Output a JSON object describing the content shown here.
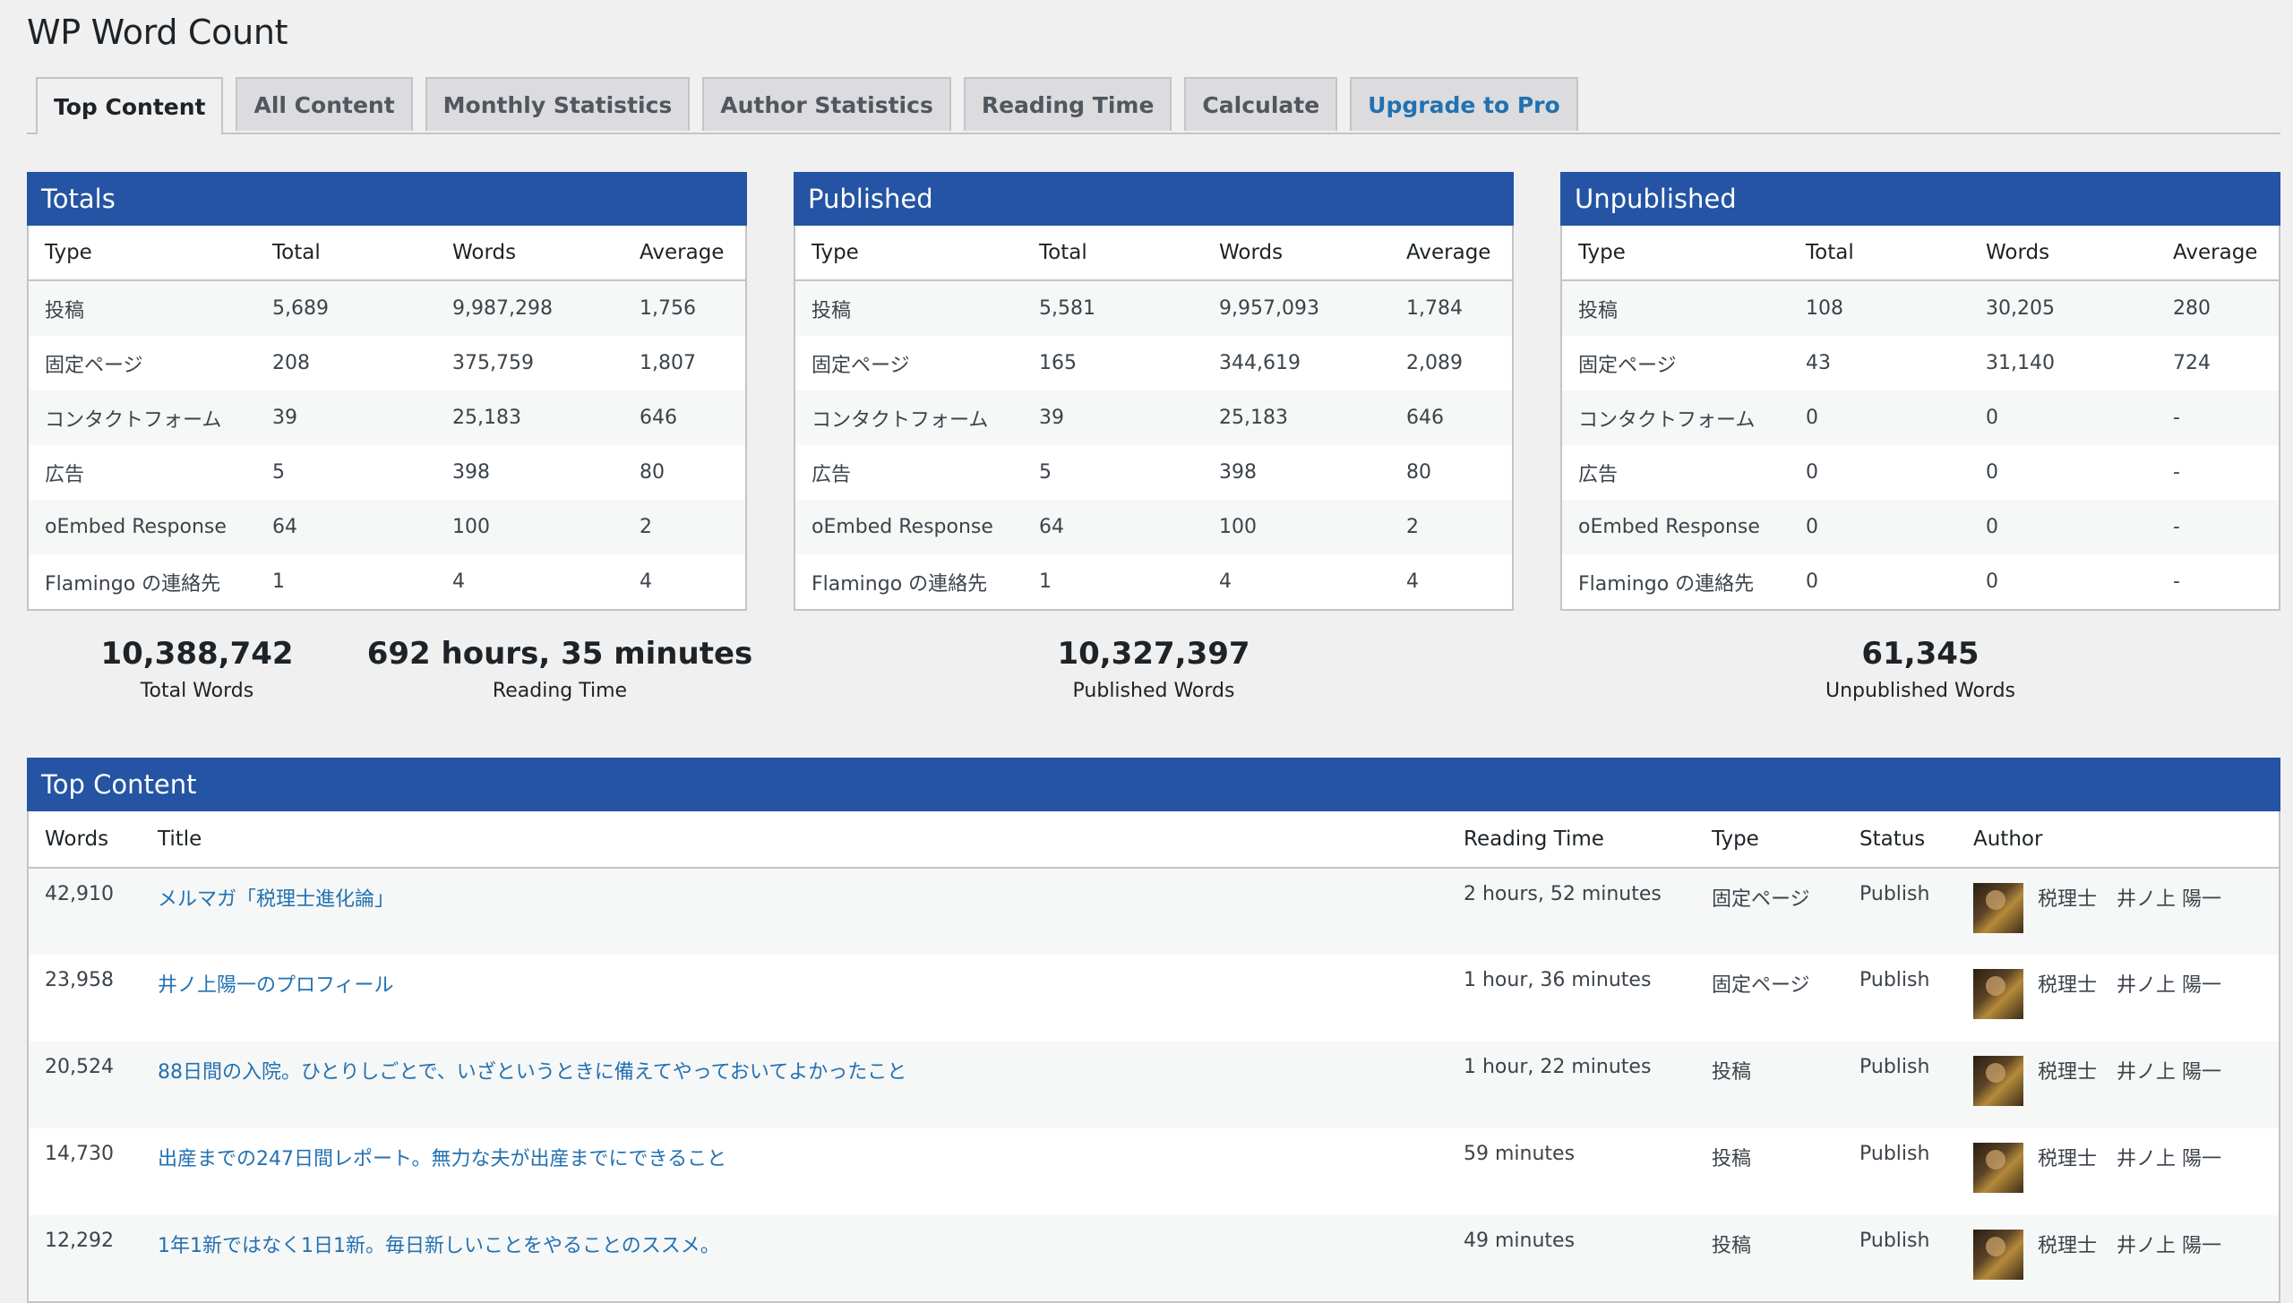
{
  "page_title": "WP Word Count",
  "tabs": [
    "Top Content",
    "All Content",
    "Monthly Statistics",
    "Author Statistics",
    "Reading Time",
    "Calculate",
    "Upgrade to Pro"
  ],
  "columns": [
    "Type",
    "Total",
    "Words",
    "Average"
  ],
  "totals": {
    "title": "Totals",
    "rows": [
      [
        "投稿",
        "5,689",
        "9,987,298",
        "1,756"
      ],
      [
        "固定ページ",
        "208",
        "375,759",
        "1,807"
      ],
      [
        "コンタクトフォーム",
        "39",
        "25,183",
        "646"
      ],
      [
        "広告",
        "5",
        "398",
        "80"
      ],
      [
        "oEmbed Response",
        "64",
        "100",
        "2"
      ],
      [
        "Flamingo の連絡先",
        "1",
        "4",
        "4"
      ]
    ]
  },
  "published": {
    "title": "Published",
    "rows": [
      [
        "投稿",
        "5,581",
        "9,957,093",
        "1,784"
      ],
      [
        "固定ページ",
        "165",
        "344,619",
        "2,089"
      ],
      [
        "コンタクトフォーム",
        "39",
        "25,183",
        "646"
      ],
      [
        "広告",
        "5",
        "398",
        "80"
      ],
      [
        "oEmbed Response",
        "64",
        "100",
        "2"
      ],
      [
        "Flamingo の連絡先",
        "1",
        "4",
        "4"
      ]
    ]
  },
  "unpublished": {
    "title": "Unpublished",
    "rows": [
      [
        "投稿",
        "108",
        "30,205",
        "280"
      ],
      [
        "固定ページ",
        "43",
        "31,140",
        "724"
      ],
      [
        "コンタクトフォーム",
        "0",
        "0",
        "-"
      ],
      [
        "広告",
        "0",
        "0",
        "-"
      ],
      [
        "oEmbed Response",
        "0",
        "0",
        "-"
      ],
      [
        "Flamingo の連絡先",
        "0",
        "0",
        "-"
      ]
    ]
  },
  "summary": {
    "total_words": "10,388,742",
    "total_words_label": "Total Words",
    "reading_time": "692 hours, 35 minutes",
    "reading_time_label": "Reading Time",
    "published_words": "10,327,397",
    "published_words_label": "Published Words",
    "unpublished_words": "61,345",
    "unpublished_words_label": "Unpublished Words"
  },
  "top_content": {
    "title": "Top Content",
    "columns": [
      "Words",
      "Title",
      "Reading Time",
      "Type",
      "Status",
      "Author"
    ],
    "rows": [
      {
        "words": "42,910",
        "title": "メルマガ「税理士進化論」",
        "reading_time": "2 hours, 52 minutes",
        "type": "固定ページ",
        "status": "Publish",
        "author": "税理士　井ノ上 陽一"
      },
      {
        "words": "23,958",
        "title": "井ノ上陽一のプロフィール",
        "reading_time": "1 hour, 36 minutes",
        "type": "固定ページ",
        "status": "Publish",
        "author": "税理士　井ノ上 陽一"
      },
      {
        "words": "20,524",
        "title": "88日間の入院。ひとりしごとで、いざというときに備えてやっておいてよかったこと",
        "reading_time": "1 hour, 22 minutes",
        "type": "投稿",
        "status": "Publish",
        "author": "税理士　井ノ上 陽一"
      },
      {
        "words": "14,730",
        "title": "出産までの247日間レポート。無力な夫が出産までにできること",
        "reading_time": "59 minutes",
        "type": "投稿",
        "status": "Publish",
        "author": "税理士　井ノ上 陽一"
      },
      {
        "words": "12,292",
        "title": "1年1新ではなく1日1新。毎日新しいことをやることのススメ。",
        "reading_time": "49 minutes",
        "type": "投稿",
        "status": "Publish",
        "author": "税理士　井ノ上 陽一"
      }
    ]
  }
}
